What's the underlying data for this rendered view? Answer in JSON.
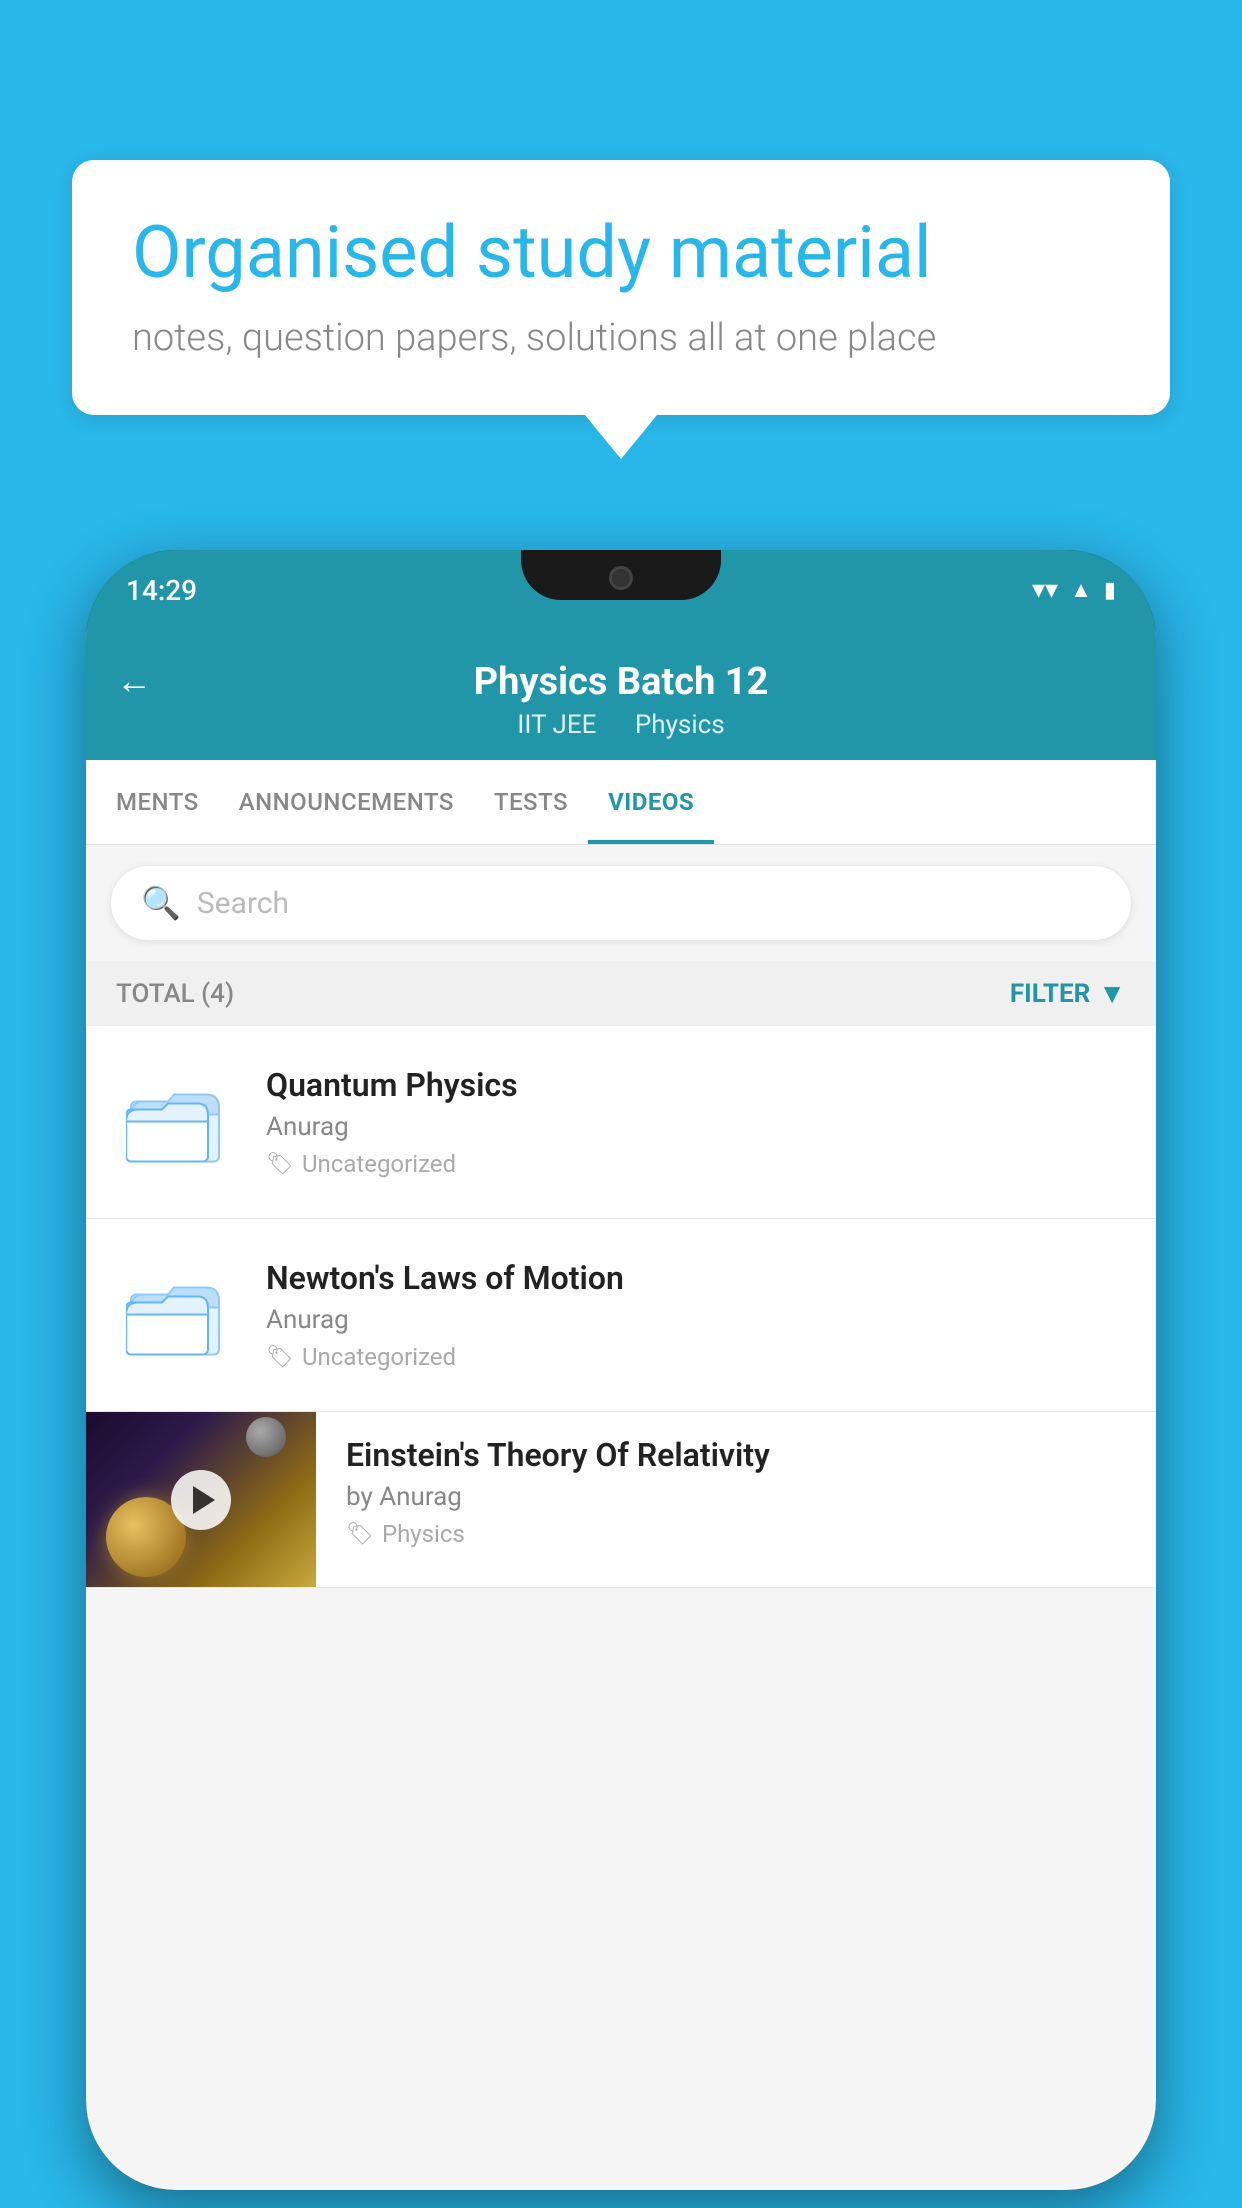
{
  "background_color": "#29b6e8",
  "speech_bubble": {
    "title": "Organised study material",
    "subtitle": "notes, question papers, solutions all at one place"
  },
  "phone": {
    "status_bar": {
      "time": "14:29"
    },
    "header": {
      "title": "Physics Batch 12",
      "subtitle_part1": "IIT JEE",
      "subtitle_part2": "Physics",
      "back_label": "←"
    },
    "tabs": [
      {
        "label": "MENTS",
        "active": false
      },
      {
        "label": "ANNOUNCEMENTS",
        "active": false
      },
      {
        "label": "TESTS",
        "active": false
      },
      {
        "label": "VIDEOS",
        "active": true
      }
    ],
    "search": {
      "placeholder": "Search"
    },
    "filter_bar": {
      "total_label": "TOTAL (4)",
      "filter_label": "FILTER"
    },
    "videos": [
      {
        "title": "Quantum Physics",
        "author": "Anurag",
        "tag": "Uncategorized",
        "has_thumbnail": false
      },
      {
        "title": "Newton's Laws of Motion",
        "author": "Anurag",
        "tag": "Uncategorized",
        "has_thumbnail": false
      },
      {
        "title": "Einstein's Theory Of Relativity",
        "author": "by Anurag",
        "tag": "Physics",
        "has_thumbnail": true
      }
    ]
  }
}
